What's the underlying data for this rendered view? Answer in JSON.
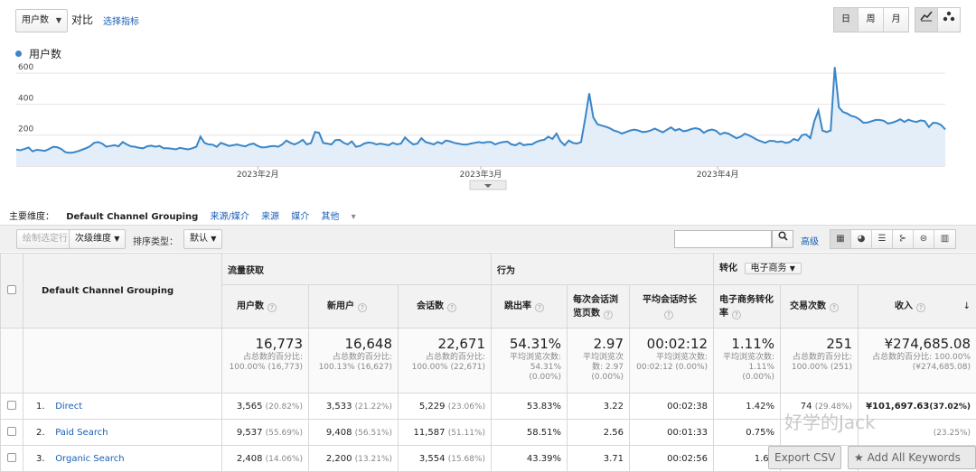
{
  "topbar": {
    "metric_select": "用户数",
    "compare_label": "对比",
    "choose_metric_link": "选择指标",
    "granularity": [
      "日",
      "周",
      "月"
    ],
    "granularity_selected": "日"
  },
  "chart_data": {
    "type": "area",
    "series": [
      {
        "name": "用户数",
        "color": "#3a86c8"
      }
    ],
    "ylabels": [
      "600",
      "400",
      "200"
    ],
    "ymax": 700,
    "xlabels": [
      "2023年2月",
      "2023年3月",
      "2023年4月"
    ],
    "values": [
      106,
      102,
      110,
      120,
      95,
      105,
      102,
      98,
      110,
      125,
      122,
      110,
      90,
      85,
      88,
      95,
      105,
      115,
      128,
      150,
      155,
      145,
      125,
      130,
      135,
      128,
      155,
      140,
      128,
      125,
      118,
      115,
      128,
      132,
      125,
      130,
      115,
      115,
      112,
      108,
      118,
      112,
      108,
      115,
      125,
      190,
      150,
      140,
      138,
      125,
      150,
      140,
      130,
      135,
      140,
      132,
      128,
      140,
      145,
      130,
      120,
      122,
      128,
      130,
      125,
      140,
      165,
      150,
      140,
      152,
      170,
      140,
      148,
      220,
      215,
      150,
      145,
      140,
      168,
      170,
      150,
      140,
      160,
      125,
      130,
      145,
      152,
      150,
      140,
      145,
      140,
      135,
      150,
      140,
      145,
      185,
      160,
      140,
      145,
      180,
      155,
      148,
      140,
      155,
      145,
      165,
      160,
      150,
      145,
      140,
      138,
      145,
      150,
      155,
      150,
      155,
      155,
      140,
      150,
      155,
      158,
      140,
      135,
      150,
      135,
      140,
      140,
      155,
      165,
      170,
      190,
      175,
      210,
      160,
      135,
      165,
      150,
      145,
      155,
      305,
      470,
      315,
      270,
      262,
      255,
      245,
      230,
      222,
      210,
      220,
      230,
      235,
      230,
      220,
      222,
      230,
      242,
      230,
      218,
      235,
      250,
      230,
      240,
      225,
      230,
      240,
      245,
      238,
      215,
      230,
      236,
      228,
      205,
      215,
      210,
      195,
      180,
      190,
      208,
      199,
      185,
      170,
      160,
      150,
      163,
      163,
      155,
      160,
      150,
      155,
      175,
      165,
      200,
      205,
      180,
      290,
      360,
      230,
      220,
      230,
      640,
      380,
      350,
      340,
      325,
      318,
      302,
      280,
      282,
      290,
      298,
      298,
      292,
      275,
      280,
      290,
      302,
      285,
      300,
      290,
      285,
      295,
      290,
      252,
      280,
      278,
      265,
      237
    ]
  },
  "dimension_bar": {
    "primary_label": "主要维度：",
    "current": "Default Channel Grouping",
    "options": [
      "来源/媒介",
      "来源",
      "媒介",
      "其他"
    ],
    "other_arrow": "▾"
  },
  "toolbar": {
    "plot_rows": "绘制选定行",
    "secondary_dim": "次级维度",
    "sort_type_label": "排序类型：",
    "sort_value": "默认",
    "advanced": "高级"
  },
  "table": {
    "dimension_header": "Default Channel Grouping",
    "groups": [
      "流量获取",
      "行为",
      "转化"
    ],
    "conversion_select": "电子商务",
    "headers": [
      "用户数",
      "新用户",
      "会话数",
      "跳出率",
      "每次会话浏览页数",
      "平均会话时长",
      "电子商务转化率",
      "交易次数",
      "收入"
    ],
    "totals": [
      {
        "value": "16,773",
        "sub": "占总数的百分比: 100.00% (16,773)"
      },
      {
        "value": "16,648",
        "sub": "占总数的百分比: 100.13% (16,627)"
      },
      {
        "value": "22,671",
        "sub": "占总数的百分比: 100.00% (22,671)"
      },
      {
        "value": "54.31%",
        "sub": "平均浏览次数: 54.31% (0.00%)"
      },
      {
        "value": "2.97",
        "sub": "平均浏览次数: 2.97 (0.00%)"
      },
      {
        "value": "00:02:12",
        "sub": "平均浏览次数: 00:02:12 (0.00%)"
      },
      {
        "value": "1.11%",
        "sub": "平均浏览次数: 1.11% (0.00%)"
      },
      {
        "value": "251",
        "sub": "占总数的百分比: 100.00% (251)"
      },
      {
        "value": "¥274,685.08",
        "sub": "占总数的百分比: 100.00% (¥274,685.08)"
      }
    ],
    "rows": [
      {
        "idx": "1.",
        "name": "Direct",
        "users": "3,565",
        "users_pct": "(20.82%)",
        "new": "3,533",
        "new_pct": "(21.22%)",
        "sessions": "5,229",
        "sessions_pct": "(23.06%)",
        "bounce": "53.83%",
        "pages": "3.22",
        "dur": "00:02:38",
        "conv": "1.42%",
        "trans": "74",
        "trans_pct": "(29.48%)",
        "rev": "¥101,697.63",
        "rev_pct": "(37.02%)"
      },
      {
        "idx": "2.",
        "name": "Paid Search",
        "users": "9,537",
        "users_pct": "(55.69%)",
        "new": "9,408",
        "new_pct": "(56.51%)",
        "sessions": "11,587",
        "sessions_pct": "(51.11%)",
        "bounce": "58.51%",
        "pages": "2.56",
        "dur": "00:01:33",
        "conv": "0.75%",
        "trans": "",
        "trans_pct": "",
        "rev": "",
        "rev_pct": "(23.25%)"
      },
      {
        "idx": "3.",
        "name": "Organic Search",
        "users": "2,408",
        "users_pct": "(14.06%)",
        "new": "2,200",
        "new_pct": "(13.21%)",
        "sessions": "3,554",
        "sessions_pct": "(15.68%)",
        "bounce": "43.39%",
        "pages": "3.71",
        "dur": "00:02:56",
        "conv": "1.66",
        "trans": "",
        "trans_pct": "",
        "rev": "",
        "rev_pct": ""
      }
    ]
  },
  "overlay": {
    "export_csv": "Export CSV",
    "add_keywords": "★ Add All Keywords",
    "watermark": "好学的Jack"
  }
}
